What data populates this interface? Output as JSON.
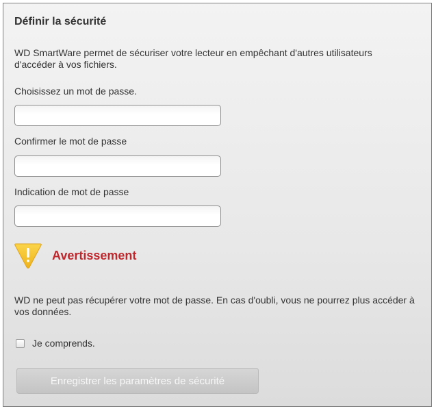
{
  "title": "Définir la sécurité",
  "description": "WD SmartWare permet de sécuriser votre lecteur en empêchant d'autres utilisateurs d'accéder à vos fichiers.",
  "password": {
    "label": "Choisissez un mot de passe.",
    "value": ""
  },
  "confirm": {
    "label": "Confirmer le mot de passe",
    "value": ""
  },
  "hint": {
    "label": "Indication de mot de passe",
    "value": ""
  },
  "warning": {
    "icon": "warning-icon",
    "title": "Avertissement",
    "text": "WD ne peut pas récupérer votre mot de passe. En cas d'oubli, vous ne pourrez plus accéder à vos données.",
    "color": "#c0272d",
    "icon_color": "#f5c531"
  },
  "acknowledge": {
    "label": "Je comprends.",
    "checked": false
  },
  "save_button": {
    "label": "Enregistrer les paramètres de sécurité",
    "enabled": false
  }
}
